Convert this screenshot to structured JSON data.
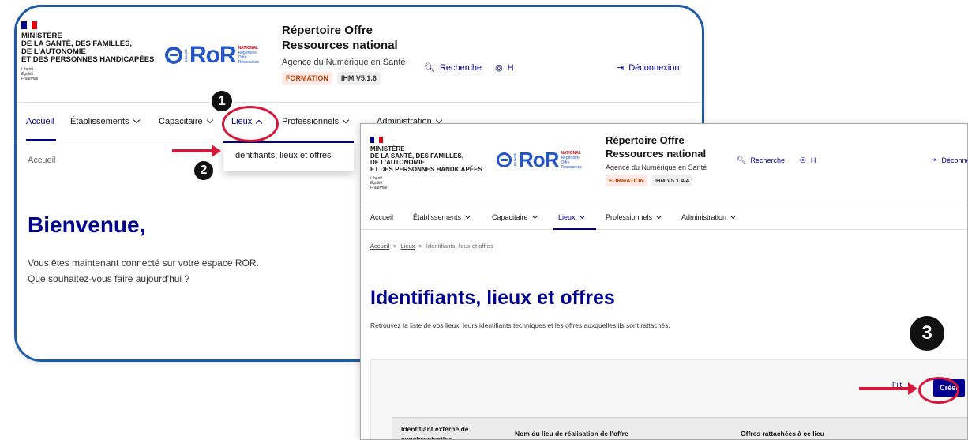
{
  "header": {
    "ministry_lines": "Ministère\nde la santé, des familles,\nde l'autonomie\net des personnes handicapées",
    "devise": "Liberté\nÉgalité\nFraternité",
    "logo_text": "RoR",
    "logo_tag": "NATIONAL",
    "logo_sub": "Répertoire\nOffre\nRessources",
    "service_title_line1": "Répertoire Offre",
    "service_title_line2": "Ressources national",
    "service_sub": "Agence du Numérique en Santé",
    "tag_env": "FORMATION",
    "search_label": "Recherche",
    "user_initial": "H",
    "logout_label": "Déconnexion"
  },
  "panel1": {
    "ihm_version": "IHM V5.1.6",
    "nav": {
      "accueil": "Accueil",
      "etablissements": "Établissements",
      "capacitaire": "Capacitaire",
      "lieux": "Lieux",
      "professionnels": "Professionnels",
      "administration": "Administration"
    },
    "dropdown_item": "Identifiants, lieux et offres",
    "breadcrumb": "Accueil",
    "welcome": "Bienvenue,",
    "desc_line1": "Vous êtes maintenant connecté sur votre espace ROR.",
    "desc_line2": "Que souhaitez-vous faire aujourd'hui ?"
  },
  "panel2": {
    "ihm_version": "IHM V5.1.4-4",
    "breadcrumb": {
      "home": "Accueil",
      "sep1": ">",
      "lieux": "Lieux",
      "sep2": ">",
      "current": "Identifiants, lieux et offres"
    },
    "title": "Identifiants, lieux et offres",
    "description": "Retrouvez la liste de vos lieux, leurs identifiants techniques et les offres auxquelles ils sont rattachés.",
    "filter_label": "Filt",
    "create_label": "Créer",
    "table_headers": [
      "Identifiant externe de synchronisation",
      "Nom du lieu de réalisation de l'offre",
      "Offres rattachées à ce lieu"
    ]
  },
  "annotations": {
    "step1": "1",
    "step2": "2",
    "step3": "3"
  },
  "colors": {
    "primary": "#000091",
    "annotation_red": "#d6163a",
    "frame_blue": "#1f5aa6"
  }
}
